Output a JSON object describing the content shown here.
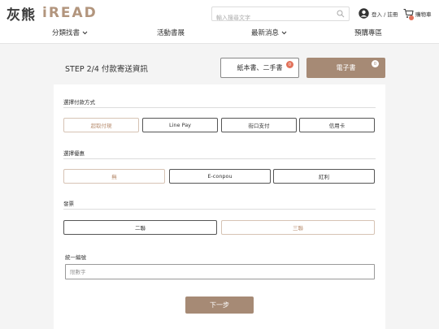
{
  "header": {
    "logo_cn": "灰熊",
    "logo_en": "iREAD",
    "search_placeholder": "輸入搜尋文字",
    "login_label": "登入 / 註冊",
    "cart_label": "購物車"
  },
  "nav": [
    {
      "label": "分類找書",
      "has_dropdown": true
    },
    {
      "label": "活動書展",
      "has_dropdown": false
    },
    {
      "label": "最新消息",
      "has_dropdown": true
    },
    {
      "label": "預購專區",
      "has_dropdown": false
    }
  ],
  "step": {
    "title": "STEP 2/4   付款寄送資訊",
    "tab_paper": {
      "label": "紙本書、二手書",
      "count": "0"
    },
    "tab_ebook": {
      "label": "電子書",
      "count": "0"
    }
  },
  "payment": {
    "label": "選擇付款方式",
    "options": [
      "超取付現",
      "Line Pay",
      "街口支付",
      "信用卡"
    ],
    "selected": "超取付現"
  },
  "discount": {
    "label": "選擇優惠",
    "options": [
      "無",
      "E-conpou",
      "紅利"
    ],
    "selected": "無"
  },
  "invoice": {
    "label": "發票",
    "options": [
      "二聯",
      "三聯"
    ],
    "selected": "三聯"
  },
  "tax_id": {
    "label": "統一編號",
    "placeholder": "限數字",
    "value": ""
  },
  "next_label": "下一步",
  "colors": {
    "brand": "#a68a75",
    "badge": "#e2725b",
    "logo_accent": "#b2957d"
  }
}
